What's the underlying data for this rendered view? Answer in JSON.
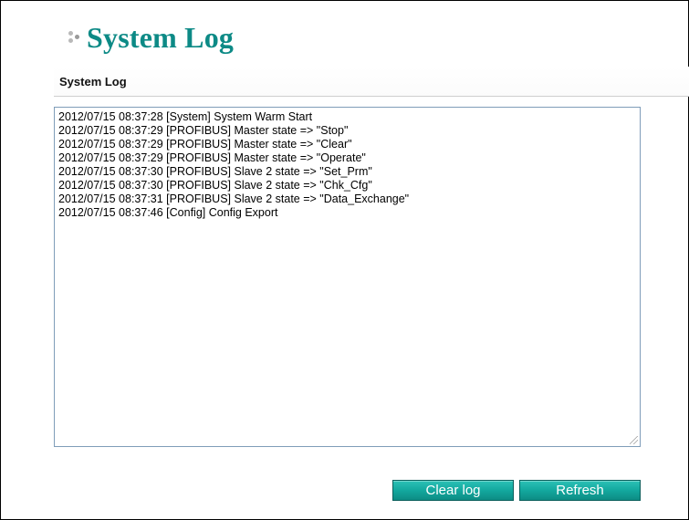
{
  "page": {
    "title": "System Log"
  },
  "section": {
    "title": "System Log"
  },
  "log": {
    "lines": [
      "2012/07/15 08:37:28 [System] System Warm Start",
      "2012/07/15 08:37:29 [PROFIBUS] Master state => \"Stop\"",
      "2012/07/15 08:37:29 [PROFIBUS] Master state => \"Clear\"",
      "2012/07/15 08:37:29 [PROFIBUS] Master state => \"Operate\"",
      "2012/07/15 08:37:30 [PROFIBUS] Slave 2 state => \"Set_Prm\"",
      "2012/07/15 08:37:30 [PROFIBUS] Slave 2 state => \"Chk_Cfg\"",
      "2012/07/15 08:37:31 [PROFIBUS] Slave 2 state => \"Data_Exchange\"",
      "2012/07/15 08:37:46 [Config] Config Export"
    ]
  },
  "buttons": {
    "clear_label": "Clear log",
    "refresh_label": "Refresh"
  },
  "colors": {
    "title": "#0d8a86",
    "button": "#13a89e",
    "log_border": "#7f9db9"
  }
}
